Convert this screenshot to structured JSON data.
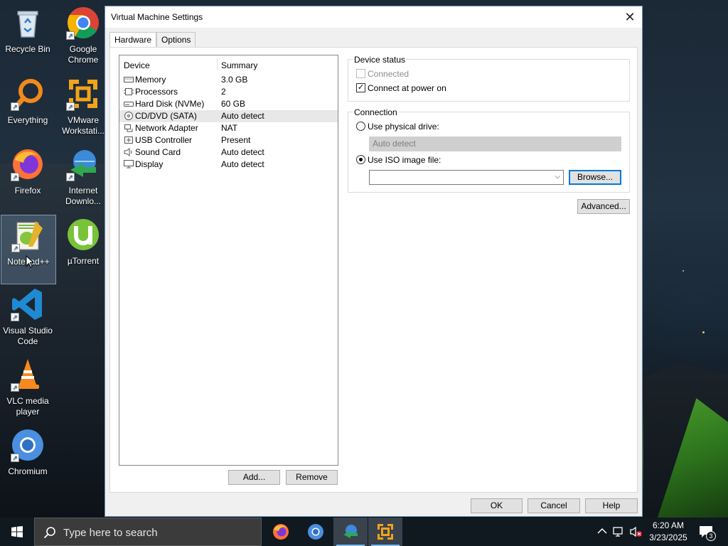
{
  "desktop": {
    "icons": [
      {
        "label": "Recycle Bin",
        "name": "recycle-bin-icon"
      },
      {
        "label": "Google Chrome",
        "name": "chrome-icon"
      },
      {
        "label": "Everything",
        "name": "everything-icon"
      },
      {
        "label": "VMware Workstati...",
        "name": "vmware-icon"
      },
      {
        "label": "Firefox",
        "name": "firefox-icon"
      },
      {
        "label": "Internet Downlo...",
        "name": "internet-download-manager-icon"
      },
      {
        "label": "Notepad++",
        "name": "notepad-plus-plus-icon"
      },
      {
        "label": "µTorrent",
        "name": "utorrent-icon"
      },
      {
        "label": "Visual Studio Code",
        "name": "vscode-icon"
      },
      {
        "label": "VLC media player",
        "name": "vlc-icon"
      },
      {
        "label": "Chromium",
        "name": "chromium-icon"
      }
    ]
  },
  "dialog": {
    "title": "Virtual Machine Settings",
    "tabs": [
      {
        "label": "Hardware",
        "active": true
      },
      {
        "label": "Options",
        "active": false
      }
    ],
    "device_list": {
      "headers": {
        "device": "Device",
        "summary": "Summary"
      },
      "rows": [
        {
          "device": "Memory",
          "summary": "3.0 GB",
          "icon": "memory-icon",
          "selected": false
        },
        {
          "device": "Processors",
          "summary": "2",
          "icon": "processor-icon",
          "selected": false
        },
        {
          "device": "Hard Disk (NVMe)",
          "summary": "60 GB",
          "icon": "hard-disk-icon",
          "selected": false
        },
        {
          "device": "CD/DVD (SATA)",
          "summary": "Auto detect",
          "icon": "cd-dvd-icon",
          "selected": true
        },
        {
          "device": "Network Adapter",
          "summary": "NAT",
          "icon": "network-adapter-icon",
          "selected": false
        },
        {
          "device": "USB Controller",
          "summary": "Present",
          "icon": "usb-icon",
          "selected": false
        },
        {
          "device": "Sound Card",
          "summary": "Auto detect",
          "icon": "speaker-icon",
          "selected": false
        },
        {
          "device": "Display",
          "summary": "Auto detect",
          "icon": "monitor-icon",
          "selected": false
        }
      ]
    },
    "add_label": "Add...",
    "remove_label": "Remove",
    "device_status": {
      "title": "Device status",
      "connected_label": "Connected",
      "connected_checked": false,
      "connect_at_power_on_label": "Connect at power on",
      "connect_at_power_on_checked": true
    },
    "connection": {
      "title": "Connection",
      "physical_drive_label": "Use physical drive:",
      "physical_drive_value": "Auto detect",
      "iso_label": "Use ISO image file:",
      "iso_value": "",
      "browse_label": "Browse...",
      "selected_option": "iso"
    },
    "advanced_label": "Advanced...",
    "ok_label": "OK",
    "cancel_label": "Cancel",
    "help_label": "Help"
  },
  "taskbar": {
    "search_placeholder": "Type here to search",
    "apps": [
      "firefox-icon",
      "chromium-icon",
      "internet-download-manager-icon",
      "vmware-icon"
    ],
    "time": "6:20 AM",
    "date": "3/23/2025",
    "notification_count": "3"
  }
}
